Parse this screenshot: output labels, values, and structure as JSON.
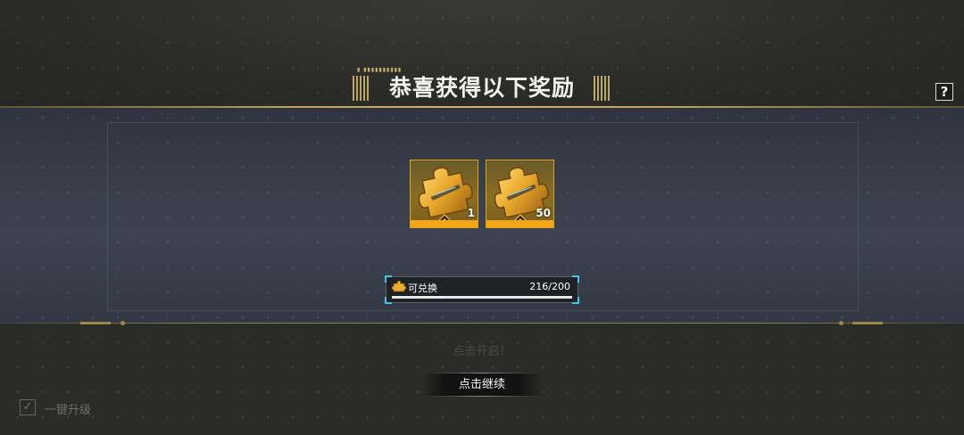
{
  "header": {
    "title": "恭喜获得以下奖励",
    "help_label": "?"
  },
  "rewards": [
    {
      "icon": "gold-puzzle-piece-icon",
      "count": "1"
    },
    {
      "icon": "gold-puzzle-piece-icon",
      "count": "50"
    }
  ],
  "exchange": {
    "label": "可兑换",
    "count": "216/200",
    "progress": 1.0
  },
  "footer": {
    "hint": "点击开启！",
    "continue_label": "点击继续",
    "upgrade_label": "一键升级",
    "upgrade_checked": true
  },
  "colors": {
    "accent_gold": "#d9a521",
    "item_bar": "#f2a516",
    "cyan_corner": "#3fc6e0"
  }
}
